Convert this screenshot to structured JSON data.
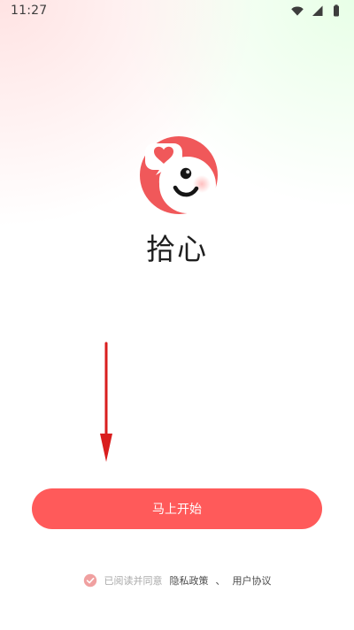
{
  "status_bar": {
    "time": "11:27",
    "icons": [
      "wifi-icon",
      "signal-icon",
      "battery-icon"
    ]
  },
  "app": {
    "name": "拾心",
    "logo": "app-logo"
  },
  "cta": {
    "label": "马上开始"
  },
  "agreement": {
    "prefix": "已阅读并同意",
    "privacy": "隐私政策",
    "separator": "、",
    "terms": "用户协议",
    "checked": true
  },
  "colors": {
    "accent": "#FF5A5A",
    "arrow": "#D91E1E",
    "text_muted": "#A9A9A9",
    "text_dark": "#1F1F1F"
  }
}
